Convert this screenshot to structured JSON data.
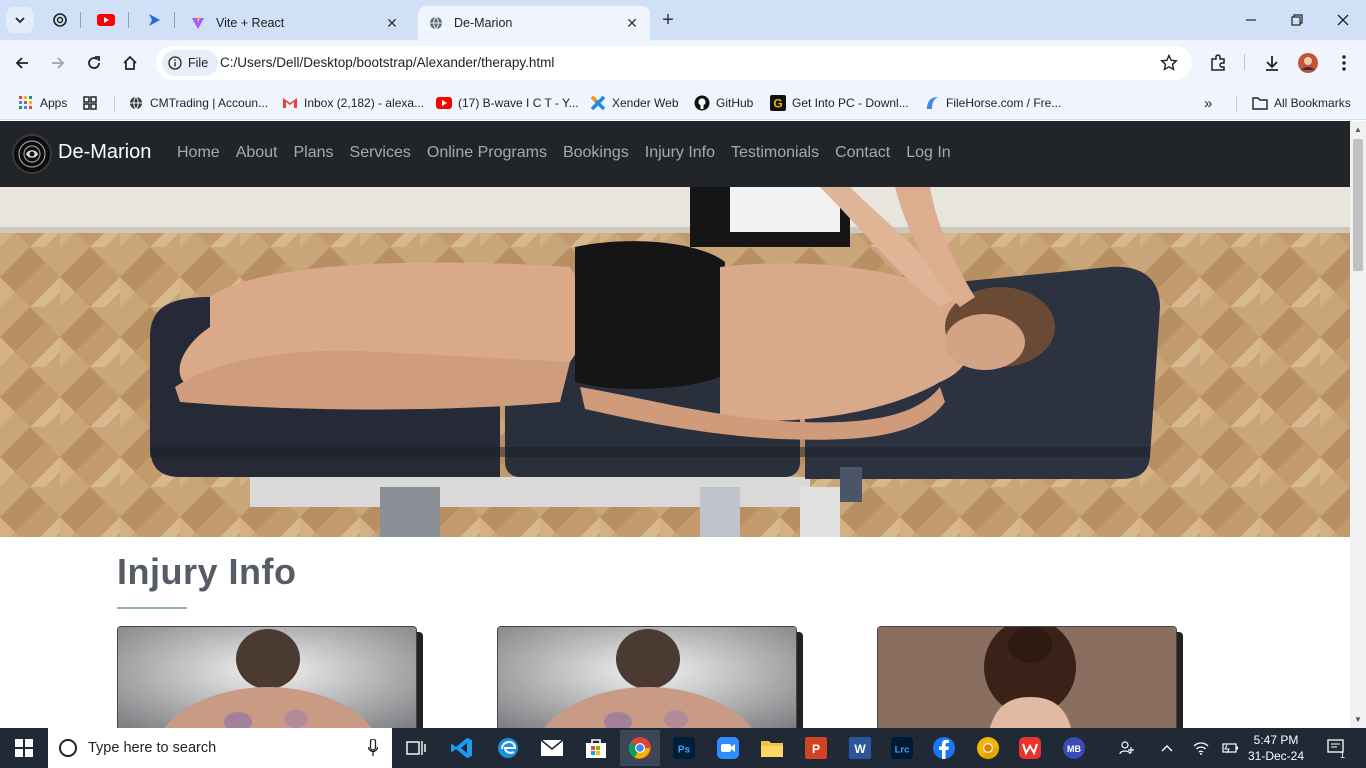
{
  "browser": {
    "tabs": [
      {
        "title": "Vite + React",
        "active": false
      },
      {
        "title": "De-Marion",
        "active": true
      }
    ],
    "address": {
      "chip_label": "File",
      "url": "C:/Users/Dell/Desktop/bootstrap/Alexander/therapy.html"
    },
    "bookmarks": [
      {
        "label": "Apps",
        "icon": "apps-grid-icon"
      },
      {
        "label": "",
        "icon": "grid-icon"
      },
      {
        "label": "CMTrading | Accoun...",
        "icon": "globe-icon"
      },
      {
        "label": "Inbox (2,182) - alexa...",
        "icon": "gmail-icon"
      },
      {
        "label": "(17) B-wave I C T - Y...",
        "icon": "youtube-icon"
      },
      {
        "label": "Xender Web",
        "icon": "xender-icon"
      },
      {
        "label": "GitHub",
        "icon": "github-icon"
      },
      {
        "label": "Get Into PC - Downl...",
        "icon": "getintopc-icon"
      },
      {
        "label": "FileHorse.com / Fre...",
        "icon": "filehorse-icon"
      }
    ],
    "all_bookmarks_label": "All Bookmarks"
  },
  "page": {
    "brand": "De-Marion",
    "nav": [
      "Home",
      "About",
      "Plans",
      "Services",
      "Online Programs",
      "Bookings",
      "Injury Info",
      "Testimonials",
      "Contact",
      "Log In"
    ],
    "section_title": "Injury Info",
    "colors": {
      "navbar": "#212529",
      "title": "#555c66",
      "accent_rule": "#8fb59a"
    }
  },
  "taskbar": {
    "search_placeholder": "Type here to search",
    "time": "5:47 PM",
    "date": "31-Dec-24",
    "notification_count": "1",
    "apps": [
      "task-view",
      "vscode",
      "edge",
      "mail",
      "store",
      "chrome",
      "photoshop",
      "zoom",
      "file-explorer",
      "powerpoint",
      "word",
      "lightroom",
      "facebook",
      "chrome-alt",
      "wps",
      "malwarebytes"
    ]
  }
}
